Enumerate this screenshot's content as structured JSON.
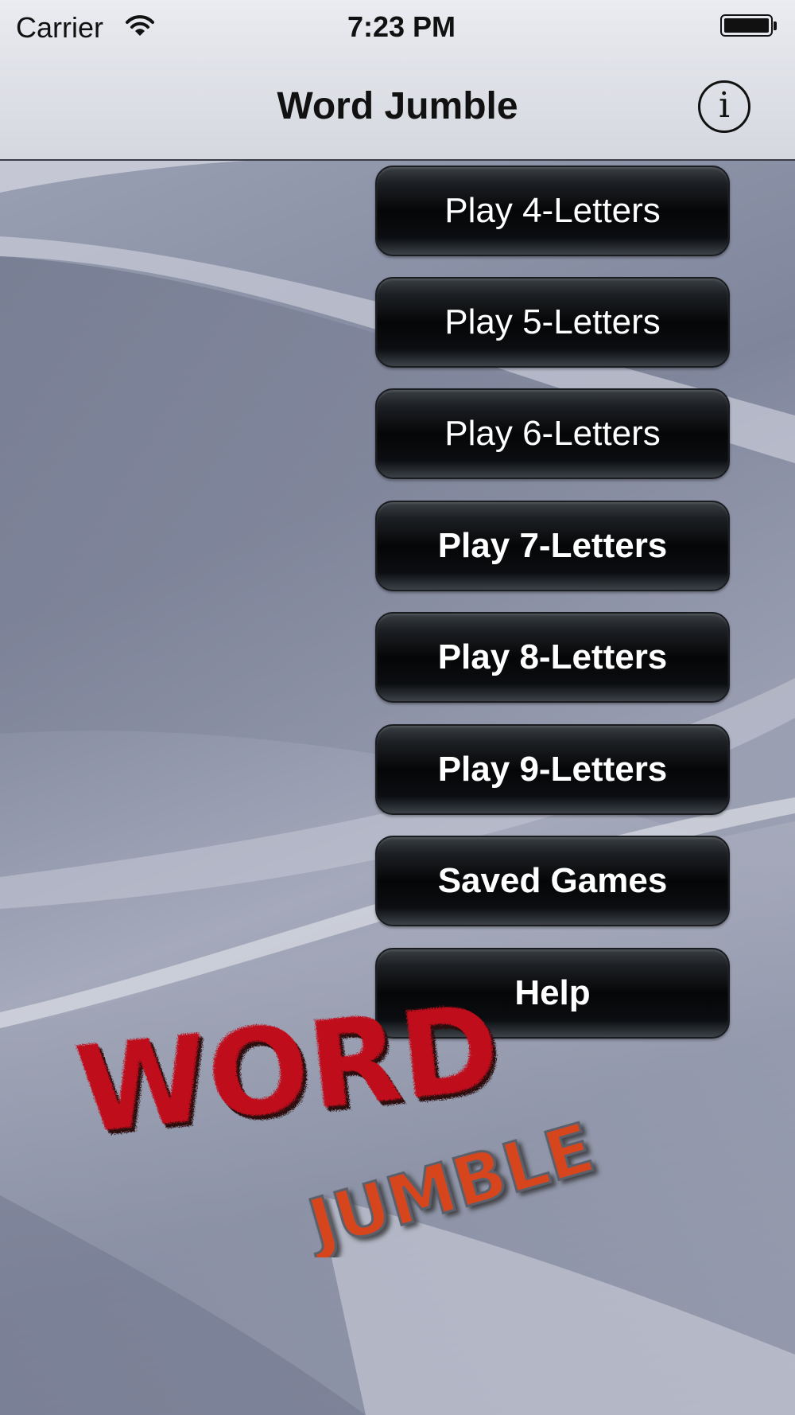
{
  "status_bar": {
    "carrier": "Carrier",
    "time": "7:23 PM",
    "icons": [
      "wifi-icon",
      "battery-icon"
    ]
  },
  "nav_bar": {
    "title": "Word Jumble",
    "info_icon": "info-icon",
    "info_glyph": "i"
  },
  "menu": {
    "items": [
      {
        "label": "Play 4-Letters",
        "bold": false
      },
      {
        "label": "Play 5-Letters",
        "bold": false
      },
      {
        "label": "Play 6-Letters",
        "bold": false
      },
      {
        "label": "Play 7-Letters",
        "bold": true
      },
      {
        "label": "Play 8-Letters",
        "bold": true
      },
      {
        "label": "Play 9-Letters",
        "bold": true
      },
      {
        "label": "Saved Games",
        "bold": true
      },
      {
        "label": "Help",
        "bold": true
      }
    ]
  },
  "logo": {
    "word1": "WORD",
    "word2": "JUMBLE",
    "word1_color": "#c0101a",
    "word2_color": "#d6451c"
  }
}
